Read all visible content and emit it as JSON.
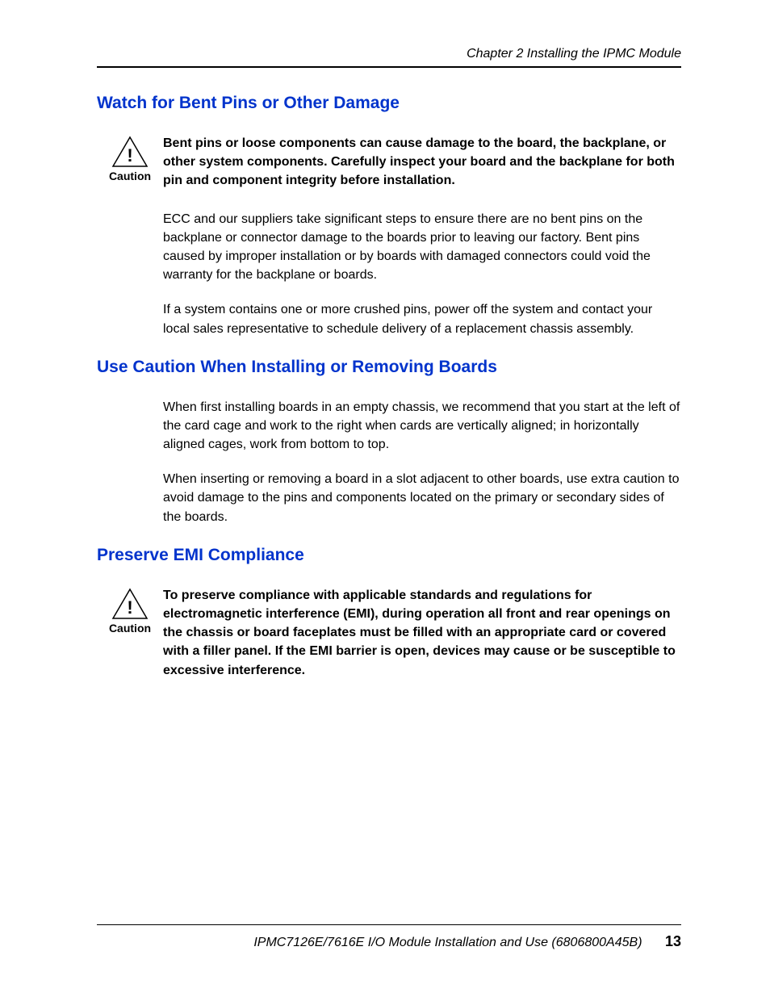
{
  "header": {
    "chapter": "Chapter 2  Installing the IPMC Module"
  },
  "sections": {
    "s1": {
      "title": "Watch for Bent Pins or Other Damage",
      "caution_label": "Caution",
      "caution_text": "Bent pins or loose components can cause damage to the board, the backplane, or other system components. Carefully inspect your board and the backplane for both pin and component integrity before installation.",
      "p1": "ECC and our suppliers take significant steps to ensure there are no bent pins on the backplane or connector damage to the boards prior to leaving our factory. Bent pins caused by improper installation or by boards with damaged connectors could void the warranty for the backplane or boards.",
      "p2": "If a system contains one or more crushed pins, power off the system and contact your local sales representative to schedule delivery of a replacement chassis assembly."
    },
    "s2": {
      "title": "Use Caution When Installing or Removing Boards",
      "p1": "When first installing boards in an empty chassis, we recommend that you start at the left of the card cage and work to the right when cards are vertically aligned; in horizontally aligned cages, work from bottom to top.",
      "p2": "When inserting or removing a board in a slot adjacent to other boards, use extra caution to avoid damage to the pins and components located on the primary or secondary sides of the boards."
    },
    "s3": {
      "title": "Preserve EMI Compliance",
      "caution_label": "Caution",
      "caution_text": "To preserve compliance with applicable standards and regulations for electromagnetic interference (EMI), during operation all front and rear openings on the chassis or board faceplates must be filled with an appropriate card or covered with a filler panel. If the EMI barrier is open, devices may cause or be susceptible to excessive interference."
    }
  },
  "footer": {
    "doc": "IPMC7126E/7616E I/O Module Installation and Use (6806800A45B)",
    "page": "13"
  }
}
